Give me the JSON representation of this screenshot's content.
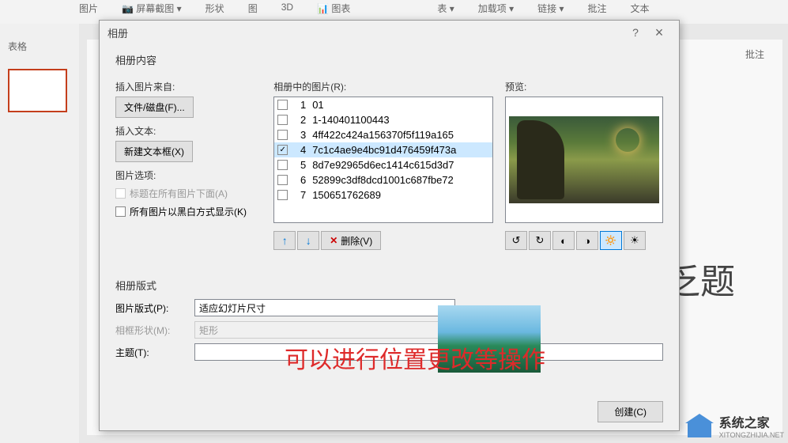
{
  "ribbon": {
    "items": [
      "图片",
      "屏幕截图",
      "形状",
      "图",
      "3D",
      "图表",
      "表",
      "加载项",
      "链接",
      "批注",
      "文本"
    ],
    "left_label": "表格",
    "right_label": "批注"
  },
  "dialog": {
    "title": "相册",
    "help": "?",
    "close": "×",
    "content_section": "相册内容",
    "insert_from": "插入图片来自:",
    "file_disk_btn": "文件/磁盘(F)...",
    "insert_text": "插入文本:",
    "new_textbox_btn": "新建文本框(X)",
    "pic_options": "图片选项:",
    "caption_below": "标题在所有图片下面(A)",
    "all_bw": "所有图片以黑白方式显示(K)",
    "pics_in_album": "相册中的图片(R):",
    "preview_label": "预览:",
    "pics": [
      {
        "num": "1",
        "name": "01",
        "checked": false
      },
      {
        "num": "2",
        "name": "1-140401100443",
        "checked": false
      },
      {
        "num": "3",
        "name": "4ff422c424a156370f5f119a165",
        "checked": false
      },
      {
        "num": "4",
        "name": "7c1c4ae9e4bc91d476459f473a",
        "checked": true
      },
      {
        "num": "5",
        "name": "8d7e92965d6ec1414c615d3d7",
        "checked": false
      },
      {
        "num": "6",
        "name": "52899c3df8dcd1001c687fbe72",
        "checked": false
      },
      {
        "num": "7",
        "name": "150651762689",
        "checked": false
      }
    ],
    "up": "↑",
    "down": "↓",
    "remove_x": "✕",
    "remove": "删除(V)",
    "format_section": "相册版式",
    "pic_format": "图片版式(P):",
    "pic_format_val": "适应幻灯片尺寸",
    "frame_shape": "相框形状(M):",
    "frame_shape_val": "矩形",
    "theme": "主题(T):",
    "create_btn": "创建(C)"
  },
  "annotation": "可以进行位置更改等操作",
  "title_text": "乏题",
  "watermark": {
    "text": "系统之家",
    "sub": "XITONGZHIJIA.NET"
  }
}
